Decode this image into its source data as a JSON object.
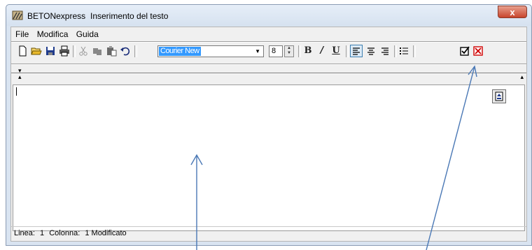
{
  "window": {
    "app_name": "BETONexpress",
    "title": "Inserimento del testo",
    "close_label": "x"
  },
  "menu": {
    "items": [
      "File",
      "Modifica",
      "Guida"
    ]
  },
  "toolbar": {
    "font_name": "Courier New",
    "font_size": "8",
    "buttons": {
      "new": "new-document-icon",
      "open": "open-folder-icon",
      "save": "save-icon",
      "print": "print-icon",
      "cut": "cut-icon",
      "copy": "copy-icon",
      "paste": "paste-icon",
      "undo": "undo-icon",
      "bold": "B",
      "italic": "/",
      "underline": "U",
      "align_left": "align-left-icon",
      "align_center": "align-center-icon",
      "align_right": "align-right-icon",
      "bullets": "bullet-list-icon",
      "confirm": "confirm-check-icon",
      "cancel": "cancel-x-icon"
    }
  },
  "status": {
    "line_label": "Linea:",
    "line_value": "1",
    "col_label": "Colonna:",
    "col_value": "1",
    "state": "Modificato"
  },
  "colors": {
    "selection": "#3399ff",
    "arrow": "#4a78b5",
    "close": "#c8452c",
    "cancel_red": "#d00000"
  }
}
